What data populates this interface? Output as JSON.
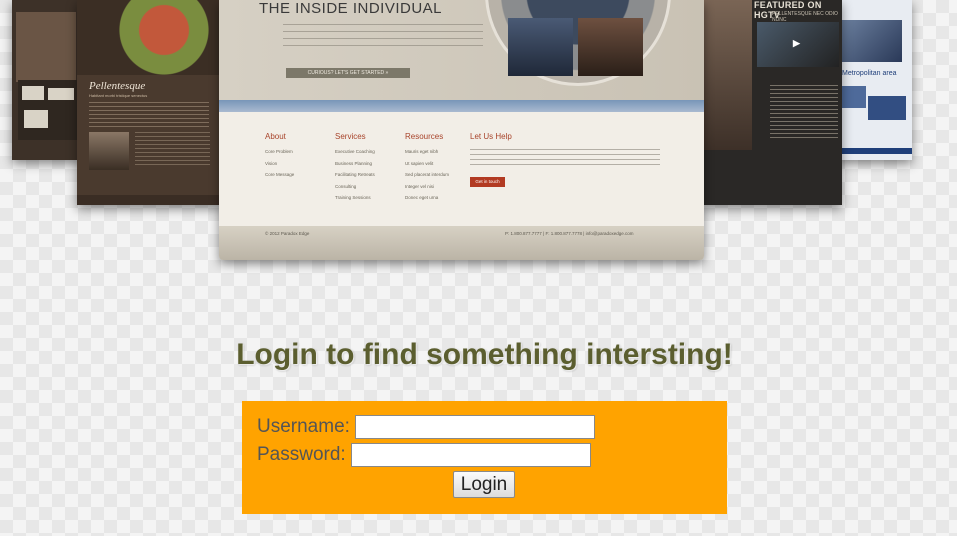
{
  "hero": {
    "center": {
      "title": "THE INSIDE INDIVIDUAL",
      "cta": "CURIOUS? LET'S GET STARTED »",
      "columns": [
        {
          "heading": "About",
          "items": [
            "Core Problem",
            "Vision",
            "Core Message"
          ]
        },
        {
          "heading": "Services",
          "items": [
            "Executive Coaching",
            "Business Planning",
            "Facilitating Retreats",
            "Consulting",
            "Training Sessions"
          ]
        },
        {
          "heading": "Resources",
          "items": [
            "Mauris eget nibh",
            "Ut sapien velit",
            "Sed placerat interdum",
            "Integer vel nisi",
            "Donec eget urna"
          ]
        },
        {
          "heading": "Let Us Help",
          "button": "Get in touch"
        }
      ],
      "copyright": "© 2012 Paradox Edge",
      "contact": "P: 1.800.877.7777  |  F: 1.800.877.7778  |  info@paradoxedge.com"
    },
    "left": {
      "brand": "Pellentesque",
      "tagline": "Habitant morbi tristique senectus"
    },
    "right": {
      "featured": "FEATURED ON HGTV",
      "sub": "PELLENTESQUE NEC ODIO NUNC"
    },
    "right_far": {
      "title": "Metropolitan area"
    }
  },
  "login": {
    "heading": "Login to find something intersting!",
    "username_label": "Username:",
    "username_value": "",
    "password_label": "Password:",
    "password_value": "",
    "button": "Login"
  },
  "colors": {
    "box": "#ffa300",
    "heading": "#5b5e2f"
  }
}
